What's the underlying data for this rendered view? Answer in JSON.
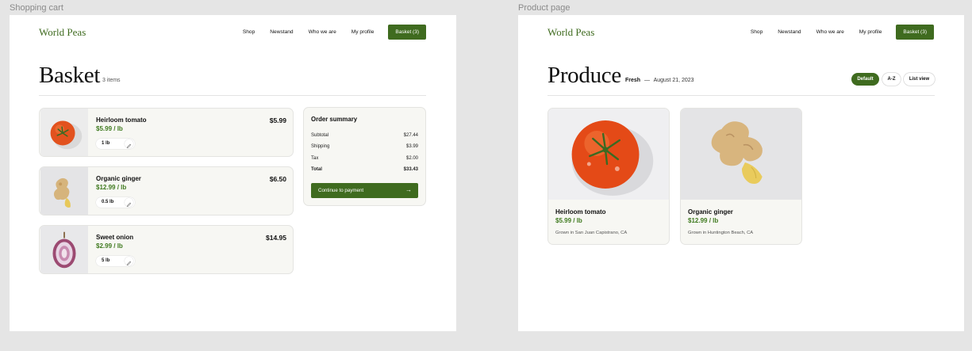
{
  "frames": {
    "cart_label": "Shopping cart",
    "product_label": "Product page"
  },
  "nav": {
    "logo": "World Peas",
    "links": [
      "Shop",
      "Newstand",
      "Who we are",
      "My profile"
    ],
    "basket": "Basket (3)"
  },
  "cart": {
    "title": "Basket",
    "count": "3 items",
    "items": [
      {
        "name": "Heirloom tomato",
        "price": "$5.99 / lb",
        "qty": "1 lb",
        "total": "$5.99",
        "image": "tomato"
      },
      {
        "name": "Organic ginger",
        "price": "$12.99 / lb",
        "qty": "0.5 lb",
        "total": "$6.50",
        "image": "ginger"
      },
      {
        "name": "Sweet onion",
        "price": "$2.99 / lb",
        "qty": "5 lb",
        "total": "$14.95",
        "image": "onion"
      }
    ],
    "summary": {
      "title": "Order summary",
      "rows": [
        {
          "label": "Subtotal",
          "value": "$27.44"
        },
        {
          "label": "Shipping",
          "value": "$3.99"
        },
        {
          "label": "Tax",
          "value": "$2.00"
        },
        {
          "label": "Total",
          "value": "$33.43"
        }
      ],
      "button": "Continue to payment",
      "button_icon": "arrow-right-icon"
    }
  },
  "product": {
    "title": "Produce",
    "subtitle_bold": "Fresh",
    "subtitle_sep": "—",
    "subtitle_date": "August 21, 2023",
    "filters": [
      {
        "label": "Default",
        "active": true
      },
      {
        "label": "A-Z",
        "active": false
      },
      {
        "label": "List view",
        "active": false
      }
    ],
    "cards": [
      {
        "name": "Heirloom tomato",
        "price": "$5.99 / lb",
        "origin": "Grown in San Juan Capistrano, CA",
        "image": "tomato"
      },
      {
        "name": "Organic ginger",
        "price": "$12.99 / lb",
        "origin": "Grown in Huntington Beach, CA",
        "image": "ginger"
      }
    ]
  },
  "colors": {
    "brand_green": "#3f6b1f",
    "price_green": "#3f7a1f",
    "card_bg": "#f7f7f3",
    "canvas_bg": "#e5e5e5"
  }
}
